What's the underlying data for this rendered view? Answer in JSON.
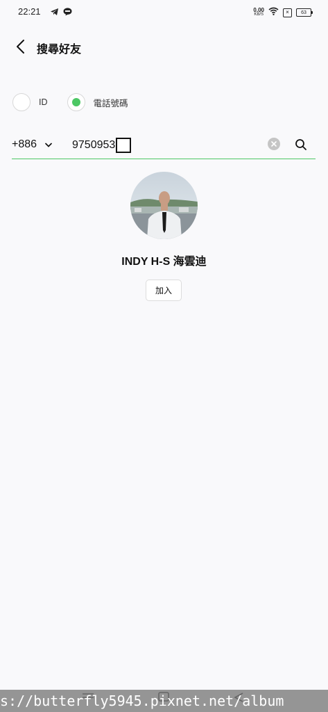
{
  "status_bar": {
    "time": "22:21",
    "left_icons": [
      "telegram-icon",
      "line-icon"
    ],
    "net_speed_value": "0.00",
    "net_speed_unit": "KB/S",
    "sim_mark": "×",
    "battery": "63"
  },
  "header": {
    "title": "搜尋好友"
  },
  "search_type": {
    "options": [
      {
        "label": "ID",
        "selected": false
      },
      {
        "label": "電話號碼",
        "selected": true
      }
    ]
  },
  "search": {
    "country_code": "+886",
    "phone_value": "9750953"
  },
  "result": {
    "name": "INDY H-S 海雲迪",
    "add_label": "加入"
  },
  "watermark": {
    "text": "s://butterfly5945.pixnet.net/album"
  },
  "colors": {
    "accent": "#4cc764",
    "background": "#f9f9fb"
  }
}
